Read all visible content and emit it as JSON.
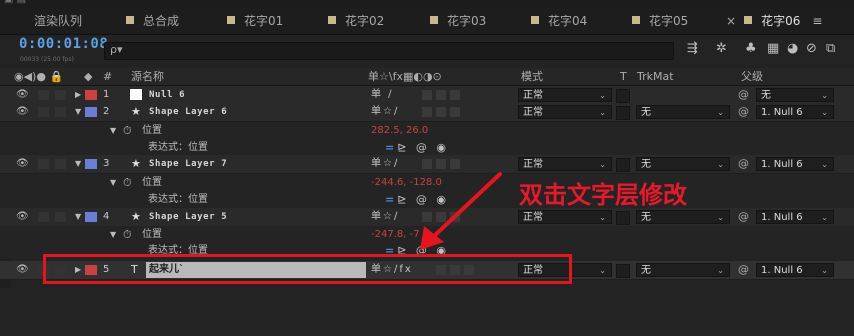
{
  "tabs": [
    {
      "label": "渲染队列",
      "marker": false
    },
    {
      "label": "总合成",
      "marker": true
    },
    {
      "label": "花字01",
      "marker": true
    },
    {
      "label": "花字02",
      "marker": true
    },
    {
      "label": "花字03",
      "marker": true
    },
    {
      "label": "花字04",
      "marker": true
    },
    {
      "label": "花字05",
      "marker": true
    },
    {
      "label": "花字06",
      "marker": true,
      "active": true
    }
  ],
  "tab_close": "×",
  "tab_menu": "≡",
  "timecode": "0:00:01:08",
  "timecode_sub": "00033 (25.00 fps)",
  "search_icon": "ρ▾",
  "headers": {
    "switch_icons": "◉◀)● 🔒",
    "label_icon": "◆",
    "num": "#",
    "source_name": "源名称",
    "switches": "单☆\\fx▦◐◑⊙",
    "mode": "模式",
    "t": "T",
    "trkmat": "TrkMat",
    "parent": "父级"
  },
  "layers": [
    {
      "num": "1",
      "icon": "□",
      "name": "Null 6",
      "label_color": "#c94141",
      "mode": "正常",
      "trkmat": "",
      "parent": "无",
      "has_trkmat": false
    },
    {
      "num": "2",
      "icon": "★",
      "name": "Shape Layer 6",
      "label_color": "#6b7ed6",
      "mode": "正常",
      "trkmat": "无",
      "parent": "1. Null 6",
      "has_trkmat": true,
      "prop_name": "位置",
      "prop_value": "282.5, 26.0",
      "expr_label": "表达式：位置"
    },
    {
      "num": "3",
      "icon": "★",
      "name": "Shape Layer 7",
      "label_color": "#6b7ed6",
      "mode": "正常",
      "trkmat": "无",
      "parent": "1. Null 6",
      "has_trkmat": true,
      "prop_name": "位置",
      "prop_value": "-244.6, -128.0",
      "expr_label": "表达式：位置"
    },
    {
      "num": "4",
      "icon": "★",
      "name": "Shape Layer 5",
      "label_color": "#6b7ed6",
      "mode": "正常",
      "trkmat": "无",
      "parent": "1. Null 6",
      "has_trkmat": true,
      "prop_name": "位置",
      "prop_value": "-247.8, -7",
      "expr_label": "表达式：位置"
    },
    {
      "num": "5",
      "icon": "T",
      "name": "起来儿`",
      "label_color": "#c94141",
      "mode": "正常",
      "trkmat": "无",
      "parent": "1. Null 6",
      "has_trkmat": true
    }
  ],
  "annotation": "双击文字层修改",
  "colors": {
    "timecode": "#5aa0e6",
    "annotation_red": "#e5141e",
    "value_red": "#c8443c",
    "expr_blue": "#4c86d6"
  }
}
